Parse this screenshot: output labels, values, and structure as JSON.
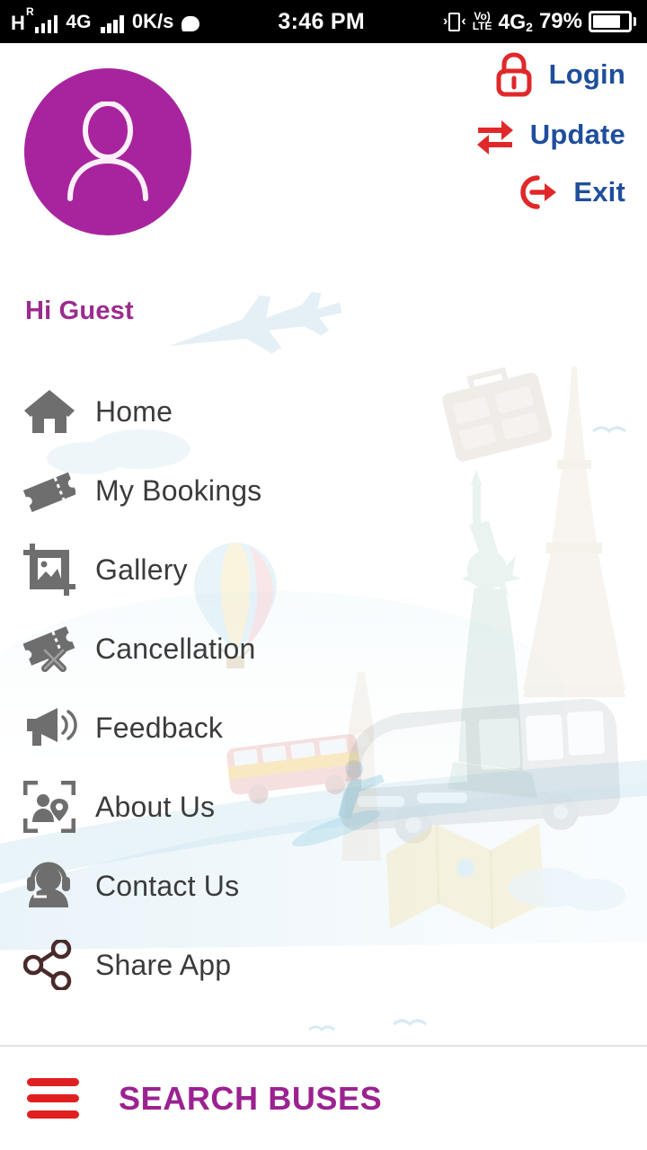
{
  "status_bar": {
    "network_type": "H",
    "roaming_indicator": "R",
    "network_type_2": "4G",
    "data_speed": "0K/s",
    "time": "3:46 PM",
    "volte_top": "Vo)",
    "volte_bottom": "LTE",
    "network_right": "4G",
    "network_right_sub": "2",
    "battery_percent": "79%",
    "battery_level": 79,
    "icons": [
      "signal-bars-icon",
      "signal-bars-2-icon",
      "chat-bubble-icon",
      "vibrate-icon",
      "volte-icon",
      "battery-icon"
    ]
  },
  "header": {
    "avatar_icon": "user-avatar-icon",
    "avatar_color": "#a8249e",
    "greeting": "Hi Guest",
    "greeting_color": "#9b2b8e",
    "actions": [
      {
        "label": "Login",
        "icon": "lock-icon"
      },
      {
        "label": "Update",
        "icon": "swap-arrows-icon"
      },
      {
        "label": "Exit",
        "icon": "exit-arrow-icon"
      }
    ],
    "action_text_color": "#1f4e9c",
    "action_icon_color": "#e0282a"
  },
  "menu": {
    "items": [
      {
        "label": "Home",
        "icon": "home-icon"
      },
      {
        "label": "My Bookings",
        "icon": "ticket-icon"
      },
      {
        "label": "Gallery",
        "icon": "image-crop-icon"
      },
      {
        "label": "Cancellation",
        "icon": "ticket-cancel-icon"
      },
      {
        "label": "Feedback",
        "icon": "megaphone-icon"
      },
      {
        "label": "About Us",
        "icon": "person-location-frame-icon"
      },
      {
        "label": "Contact Us",
        "icon": "headset-support-icon"
      },
      {
        "label": "Share App",
        "icon": "share-nodes-icon"
      }
    ],
    "icon_color": "#6e6e6e",
    "label_color": "#3b3b3b"
  },
  "bottom_bar": {
    "menu_icon": "hamburger-menu-icon",
    "menu_icon_color": "#e02020",
    "title": "SEARCH BUSES",
    "title_color": "#9b2290"
  }
}
